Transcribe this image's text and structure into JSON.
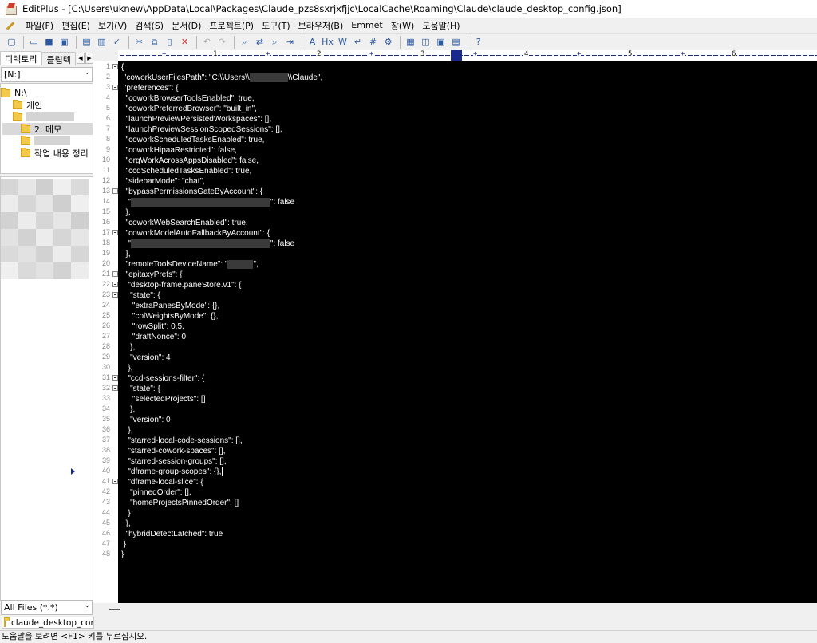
{
  "window": {
    "title": "EditPlus - [C:\\Users\\uknew\\AppData\\Local\\Packages\\Claude_pzs8sxrjxfjjc\\LocalCache\\Roaming\\Claude\\claude_desktop_config.json]"
  },
  "menu": [
    "파일(F)",
    "편집(E)",
    "보기(V)",
    "검색(S)",
    "문서(D)",
    "프로젝트(P)",
    "도구(T)",
    "브라우저(B)",
    "Emmet",
    "창(W)",
    "도움말(H)"
  ],
  "toolbar_icons": [
    "new-file-icon",
    "open-file-icon",
    "save-icon",
    "save-all-icon",
    "print-preview-icon",
    "print-icon",
    "spell-icon",
    "cut-icon",
    "copy-icon",
    "paste-icon",
    "delete-icon",
    "undo-icon",
    "redo-icon",
    "find-icon",
    "replace-icon",
    "find-in-files-icon",
    "goto-icon",
    "font-icon",
    "hex-icon",
    "html-icon",
    "word-wrap-icon",
    "line-number-icon",
    "settings-icon",
    "browser-icon",
    "split-icon",
    "window-icon",
    "cliptext-icon",
    "help-icon"
  ],
  "left_panel": {
    "tabs": [
      "디렉토리",
      "클립텍"
    ],
    "drive": "[N:]",
    "tree": [
      {
        "label": "N:\\",
        "indent": 1
      },
      {
        "label": "개인",
        "indent": 2
      },
      {
        "label": "",
        "indent": 3
      },
      {
        "label": "2. 메모",
        "indent": 3,
        "selected": true
      },
      {
        "label": "",
        "indent": 4
      },
      {
        "label": "작업 내용 정리",
        "indent": 4
      }
    ],
    "filter": "All Files (*.*)"
  },
  "ruler": {
    "numbers": [
      "1",
      "2",
      "3",
      "4",
      "5",
      "6"
    ]
  },
  "editor": {
    "lines": [
      {
        "n": "1",
        "fold": true,
        "text": "{"
      },
      {
        "n": "2",
        "fold": false,
        "text": " \"coworkUserFilesPath\": \"C:\\\\Users\\\\",
        "redact": 48,
        "after": "\\\\Claude\","
      },
      {
        "n": "3",
        "fold": true,
        "text": " \"preferences\": {"
      },
      {
        "n": "4",
        "fold": false,
        "text": "  \"coworkBrowserToolsEnabled\": true,"
      },
      {
        "n": "5",
        "fold": false,
        "text": "  \"coworkPreferredBrowser\": \"built_in\","
      },
      {
        "n": "6",
        "fold": false,
        "text": "  \"launchPreviewPersistedWorkspaces\": [],"
      },
      {
        "n": "7",
        "fold": false,
        "text": "  \"launchPreviewSessionScopedSessions\": [],"
      },
      {
        "n": "8",
        "fold": false,
        "text": "  \"coworkScheduledTasksEnabled\": true,"
      },
      {
        "n": "9",
        "fold": false,
        "text": "  \"coworkHipaaRestricted\": false,"
      },
      {
        "n": "10",
        "fold": false,
        "text": "  \"orgWorkAcrossAppsDisabled\": false,"
      },
      {
        "n": "11",
        "fold": false,
        "text": "  \"ccdScheduledTasksEnabled\": true,"
      },
      {
        "n": "12",
        "fold": false,
        "text": "  \"sidebarMode\": \"chat\","
      },
      {
        "n": "13",
        "fold": true,
        "text": "  \"bypassPermissionsGateByAccount\": {"
      },
      {
        "n": "14",
        "fold": false,
        "text": "   \"",
        "redact": 175,
        "after": "\": false"
      },
      {
        "n": "15",
        "fold": false,
        "text": "  },"
      },
      {
        "n": "16",
        "fold": false,
        "text": "  \"coworkWebSearchEnabled\": true,"
      },
      {
        "n": "17",
        "fold": true,
        "text": "  \"coworkModelAutoFallbackByAccount\": {"
      },
      {
        "n": "18",
        "fold": false,
        "text": "   \"",
        "redact": 175,
        "after": "\": false"
      },
      {
        "n": "19",
        "fold": false,
        "text": "  },"
      },
      {
        "n": "20",
        "fold": false,
        "text": "  \"remoteToolsDeviceName\": \"",
        "redact": 32,
        "after": "\","
      },
      {
        "n": "21",
        "fold": true,
        "text": "  \"epitaxyPrefs\": {"
      },
      {
        "n": "22",
        "fold": true,
        "text": "   \"desktop-frame.paneStore.v1\": {"
      },
      {
        "n": "23",
        "fold": true,
        "text": "    \"state\": {"
      },
      {
        "n": "24",
        "fold": false,
        "text": "     \"extraPanesByMode\": {},"
      },
      {
        "n": "25",
        "fold": false,
        "text": "     \"colWeightsByMode\": {},"
      },
      {
        "n": "26",
        "fold": false,
        "text": "     \"rowSplit\": 0.5,"
      },
      {
        "n": "27",
        "fold": false,
        "text": "     \"draftNonce\": 0"
      },
      {
        "n": "28",
        "fold": false,
        "text": "    },"
      },
      {
        "n": "29",
        "fold": false,
        "text": "    \"version\": 4"
      },
      {
        "n": "30",
        "fold": false,
        "text": "   },"
      },
      {
        "n": "31",
        "fold": true,
        "text": "   \"ccd-sessions-filter\": {"
      },
      {
        "n": "32",
        "fold": true,
        "text": "    \"state\": {"
      },
      {
        "n": "33",
        "fold": false,
        "text": "     \"selectedProjects\": []"
      },
      {
        "n": "34",
        "fold": false,
        "text": "    },"
      },
      {
        "n": "35",
        "fold": false,
        "text": "    \"version\": 0"
      },
      {
        "n": "36",
        "fold": false,
        "text": "   },"
      },
      {
        "n": "37",
        "fold": false,
        "text": "   \"starred-local-code-sessions\": [],"
      },
      {
        "n": "38",
        "fold": false,
        "text": "   \"starred-cowork-spaces\": [],"
      },
      {
        "n": "39",
        "fold": false,
        "text": "   \"starred-session-groups\": [],"
      },
      {
        "n": "40",
        "fold": false,
        "text": "   \"dframe-group-scopes\": {},",
        "current": true
      },
      {
        "n": "41",
        "fold": true,
        "text": "   \"dframe-local-slice\": {"
      },
      {
        "n": "42",
        "fold": false,
        "text": "    \"pinnedOrder\": [],"
      },
      {
        "n": "43",
        "fold": false,
        "text": "    \"homeProjectsPinnedOrder\": []"
      },
      {
        "n": "44",
        "fold": false,
        "text": "   }"
      },
      {
        "n": "45",
        "fold": false,
        "text": "  },"
      },
      {
        "n": "46",
        "fold": false,
        "text": "  \"hybridDetectLatched\": true"
      },
      {
        "n": "47",
        "fold": false,
        "text": " }"
      },
      {
        "n": "48",
        "fold": false,
        "text": "}"
      }
    ]
  },
  "doc_tab": {
    "label": "claude_desktop_config.json"
  },
  "status": {
    "text": "도움말을 보려면 <F1> 키를 누르십시오."
  },
  "colors": {
    "editor_bg": "#000000",
    "editor_fg": "#ffffff",
    "ruler": "#1a2a8a"
  }
}
